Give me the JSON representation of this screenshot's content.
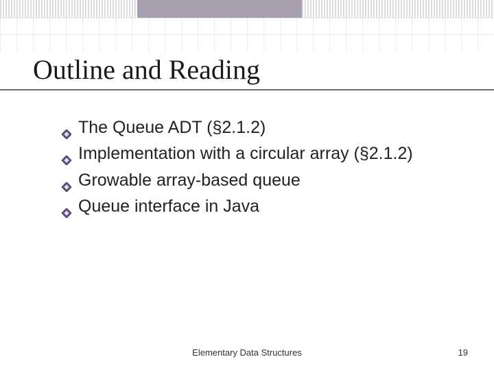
{
  "slide": {
    "title": "Outline and Reading",
    "bullets": [
      "The Queue ADT (§2.1.2)",
      "Implementation with a circular array (§2.1.2)",
      "Growable array-based queue",
      "Queue interface in Java"
    ],
    "footer": "Elementary Data Structures",
    "page_number": "19"
  },
  "colors": {
    "accent": "#5a4a7a",
    "title_text": "#1a1a1a",
    "body_text": "#222222"
  }
}
